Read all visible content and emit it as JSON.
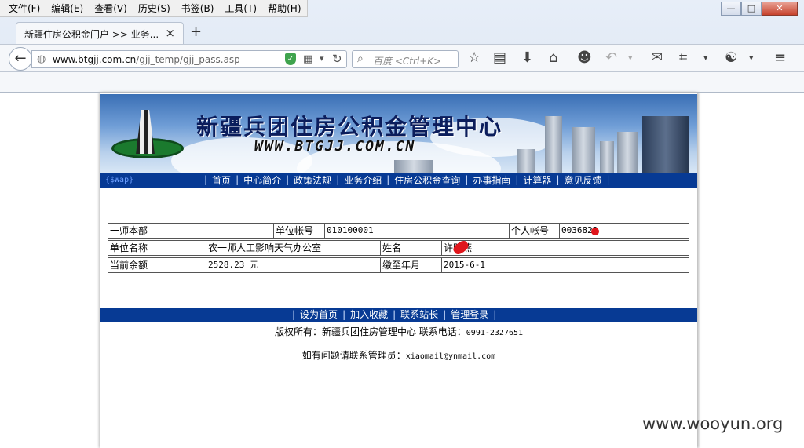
{
  "browser": {
    "menu": [
      "文件(F)",
      "编辑(E)",
      "查看(V)",
      "历史(S)",
      "书签(B)",
      "工具(T)",
      "帮助(H)"
    ],
    "window_controls": {
      "minimize": "—",
      "maximize": "□",
      "close": "✕"
    },
    "tab": {
      "title": "新疆住房公积金门户 >> 业务...",
      "close": "×"
    },
    "new_tab": "+",
    "url": {
      "host": "www.btgjj.com.cn",
      "path": "/gjj_temp/gjj_pass.asp"
    },
    "search_placeholder": "百度 <Ctrl+K>",
    "icons": [
      "star-icon",
      "reading-list-icon",
      "download-icon",
      "home-icon",
      "smiley-icon",
      "undo-icon",
      "chat-icon",
      "crop-icon",
      "extension-icon",
      "menu-icon"
    ]
  },
  "site": {
    "title": "新疆兵团住房公积金管理中心",
    "url_text": "WWW.BTGJJ.COM.CN",
    "wap_label": "{$Wap}",
    "nav": [
      "首页",
      "中心简介",
      "政策法规",
      "业务介绍",
      "住房公积金查询",
      "办事指南",
      "计算器",
      "意见反馈"
    ]
  },
  "account": {
    "row1": {
      "dept": "一师本部",
      "unit_acct_label": "单位帐号",
      "unit_acct_value": "010100001",
      "personal_acct_label": "个人帐号",
      "personal_acct_value": "0036822"
    },
    "row2": {
      "unit_name_label": "单位名称",
      "unit_name_value": "农一师人工影响天气办公室",
      "name_label": "姓名",
      "name_value": "许明燕"
    },
    "row3": {
      "balance_label": "当前余额",
      "balance_value": "2528.23 元",
      "paid_until_label": "缴至年月",
      "paid_until_value": "2015-6-1"
    }
  },
  "footer": {
    "links": [
      "设为首页",
      "加入收藏",
      "联系站长",
      "管理登录"
    ],
    "copyright_prefix": "版权所有：新疆兵团住房管理中心 联系电话：",
    "phone": "0991-2327651",
    "contact_prefix": "如有问题请联系管理员：",
    "email": "xiaomail@ynmail.com"
  },
  "watermark": "www.wooyun.org"
}
